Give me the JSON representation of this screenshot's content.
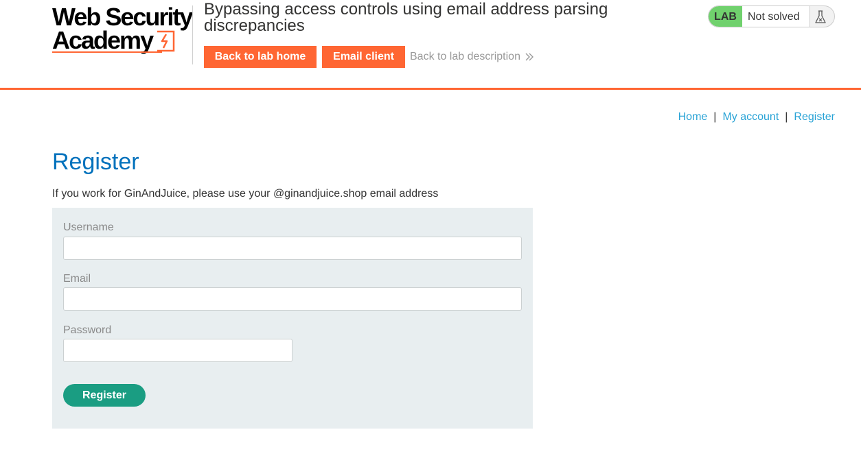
{
  "header": {
    "logo": {
      "line1": "Web Security",
      "line2": "Academy"
    },
    "lab_title": "Bypassing access controls using email address parsing discrepancies",
    "buttons": {
      "back_to_lab_home": "Back to lab home",
      "email_client": "Email client"
    },
    "back_to_description": "Back to lab description",
    "status": {
      "tag": "LAB",
      "state": "Not solved",
      "icon": "flask-icon"
    }
  },
  "nav": {
    "home": "Home",
    "my_account": "My account",
    "register": "Register",
    "separator": "|"
  },
  "main": {
    "title": "Register",
    "intro": "If you work for GinAndJuice, please use your @ginandjuice.shop email address",
    "form": {
      "username_label": "Username",
      "username_value": "",
      "email_label": "Email",
      "email_value": "",
      "password_label": "Password",
      "password_value": "",
      "submit_label": "Register"
    }
  },
  "colors": {
    "accent_orange": "#ff6633",
    "title_blue": "#0071bc",
    "link_blue": "#29a3d6",
    "lab_green": "#70d16d",
    "register_green": "#1a9d82",
    "panel_bg": "#e8eef0"
  }
}
